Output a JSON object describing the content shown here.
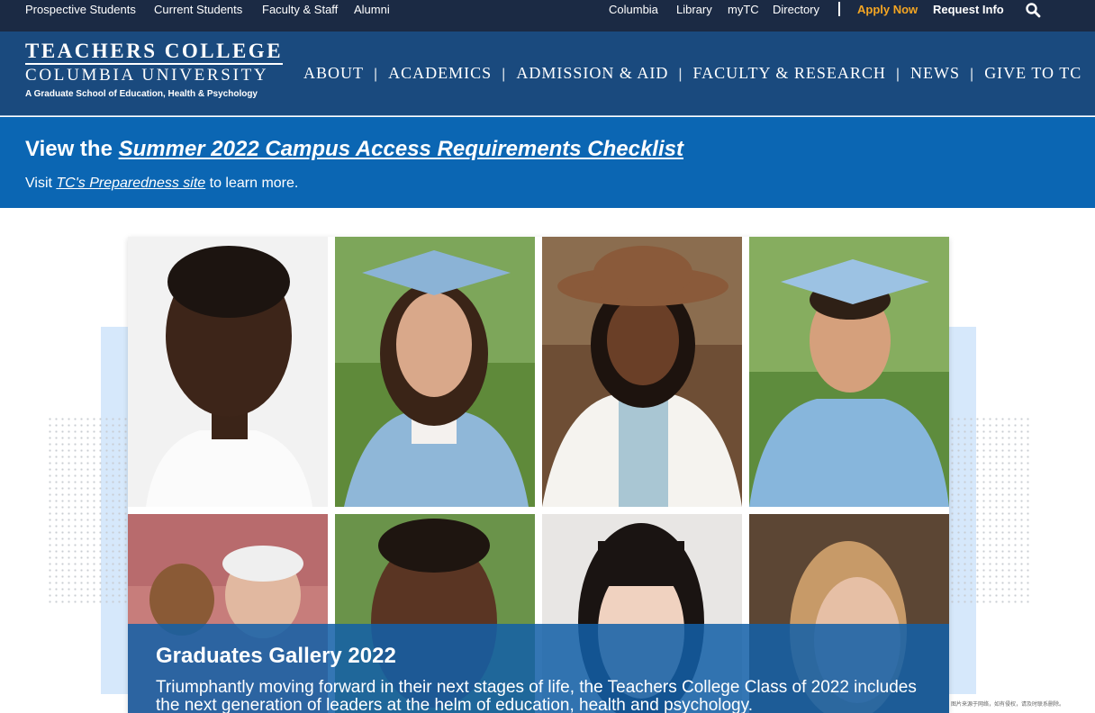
{
  "utility_nav": {
    "left": [
      "Prospective Students",
      "Current Students",
      "Faculty & Staff",
      "Alumni"
    ],
    "right": [
      "Columbia",
      "Library",
      "myTC",
      "Directory"
    ],
    "apply_now": "Apply Now",
    "request_info": "Request Info",
    "search_icon": "search-icon"
  },
  "logo": {
    "line1": "TEACHERS COLLEGE",
    "line2": "COLUMBIA UNIVERSITY",
    "tagline": "A Graduate School of Education, Health & Psychology"
  },
  "main_nav": [
    "ABOUT",
    "ACADEMICS",
    "ADMISSION & AID",
    "FACULTY & RESEARCH",
    "NEWS",
    "GIVE TO TC"
  ],
  "alert": {
    "heading_prefix": "View the ",
    "heading_link": "Summer 2022 Campus Access Requirements Checklist",
    "sub_prefix": "Visit ",
    "sub_link": "TC's Preparedness site",
    "sub_suffix": " to learn more."
  },
  "feature": {
    "title": "Graduates Gallery 2022",
    "description": "Triumphantly moving forward in their next stages of life, the Teachers College Class of 2022 includes the next generation of leaders at the helm of education, health and psychology."
  },
  "watermark_text": "图片来源于网络，如有侵权，请及时联系删除。",
  "colors": {
    "utility_bg": "#1b2a44",
    "header_bg": "#1a4a7e",
    "alert_bg": "#0b66b3",
    "apply_accent": "#f5a623",
    "caption_bg": "#1360a8"
  }
}
